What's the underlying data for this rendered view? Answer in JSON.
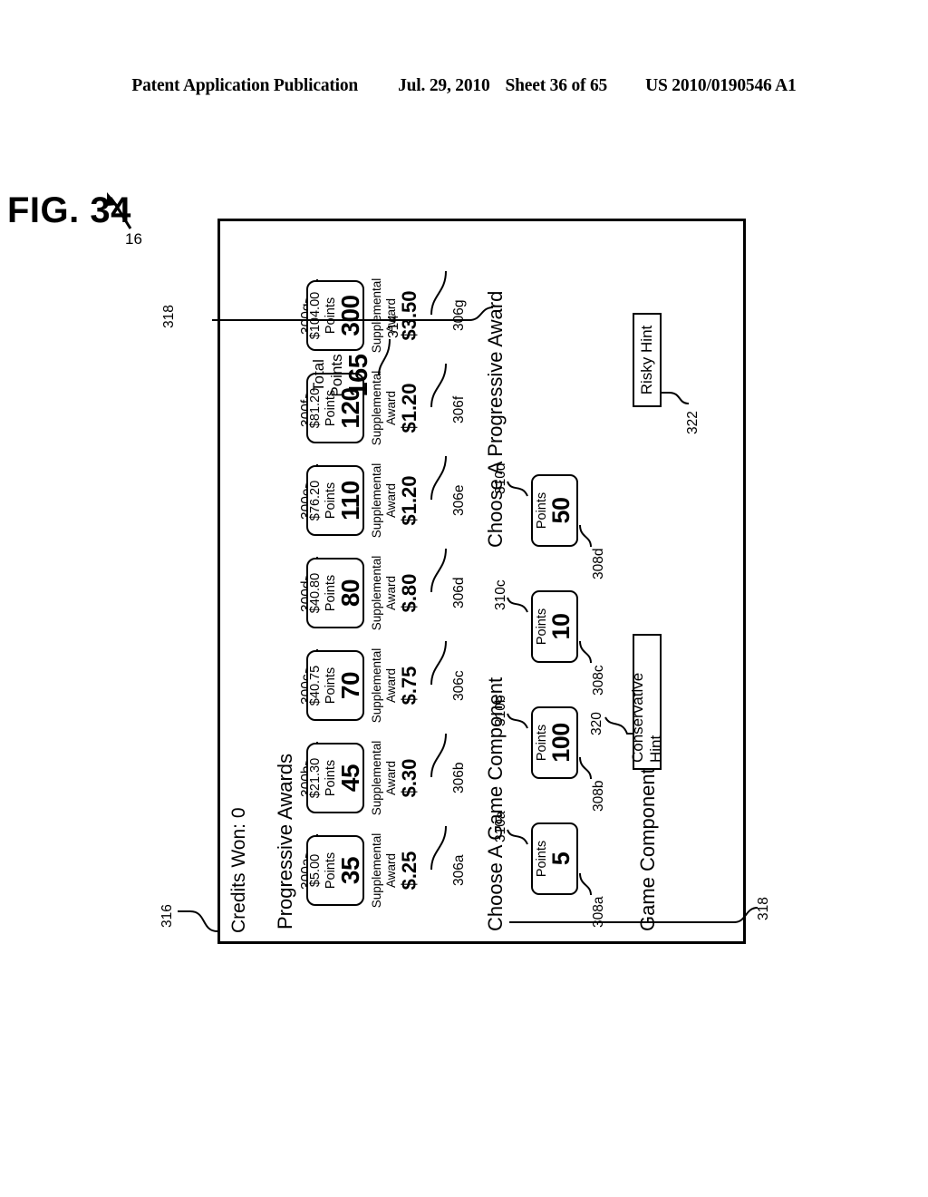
{
  "page_header": {
    "publication": "Patent Application Publication",
    "date": "Jul. 29, 2010",
    "sheet": "Sheet 36 of 65",
    "patent_number": "US 2010/0190546 A1"
  },
  "figure": {
    "caption": "FIG. 34",
    "device_ref": "16",
    "screen_ref_top": "316",
    "screen_ref_mid": "318",
    "screen_ref_bottom": "318"
  },
  "screen": {
    "credits_won": "Credits Won: 0",
    "progressive_awards_title": "Progressive Awards",
    "choose_progressive_label": "Choose A Progressive Award",
    "choose_game_component_label": "Choose A Game Component",
    "game_components_title": "Game Components",
    "supplemental_line1": "Supplemental",
    "supplemental_line2": "Award",
    "points_word": "Points",
    "total_line1": "Total",
    "total_line2": "Points",
    "total_points_value": "165",
    "total_points_ref": "314"
  },
  "progressive_awards": [
    {
      "ref": "300a",
      "amount": "$5.00",
      "points_label": "Points",
      "points": "35",
      "supplemental": "$.25",
      "sup_ref": "306a"
    },
    {
      "ref": "300b",
      "amount": "$21.30",
      "points_label": "Points",
      "points": "45",
      "supplemental": "$.30",
      "sup_ref": "306b"
    },
    {
      "ref": "300c",
      "amount": "$40.75",
      "points_label": "Points",
      "points": "70",
      "supplemental": "$.75",
      "sup_ref": "306c"
    },
    {
      "ref": "300d",
      "amount": "$40.80",
      "points_label": "Points",
      "points": "80",
      "supplemental": "$.80",
      "sup_ref": "306d"
    },
    {
      "ref": "300e",
      "amount": "$76.20",
      "points_label": "Points",
      "points": "110",
      "supplemental": "$1.20",
      "sup_ref": "306e"
    },
    {
      "ref": "300f",
      "amount": "$81.20",
      "points_label": "Points",
      "points": "120",
      "supplemental": "$1.20",
      "sup_ref": "306f"
    },
    {
      "ref": "300g",
      "amount": "$104.00",
      "points_label": "Points",
      "points": "300",
      "supplemental": "$3.50",
      "sup_ref": "306g"
    }
  ],
  "game_components": [
    {
      "box_ref": "308a",
      "points_label": "Points",
      "points": "5",
      "value_ref": "310a"
    },
    {
      "box_ref": "308b",
      "points_label": "Points",
      "points": "100",
      "value_ref": "310b"
    },
    {
      "box_ref": "308c",
      "points_label": "Points",
      "points": "10",
      "value_ref": "310c"
    },
    {
      "box_ref": "308d",
      "points_label": "Points",
      "points": "50",
      "value_ref": "310d"
    }
  ],
  "hints": [
    {
      "label": "Conservative Hint",
      "ref": "320"
    },
    {
      "label": "Risky Hint",
      "ref": "322"
    }
  ]
}
